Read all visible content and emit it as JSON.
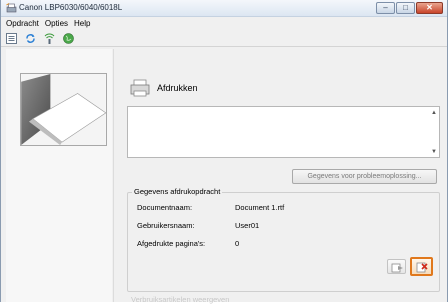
{
  "window": {
    "title": "Canon LBP6030/6040/6018L",
    "caption_buttons": {
      "minimize": "–",
      "maximize": "□",
      "close": "✕"
    }
  },
  "menu": [
    "Opdracht",
    "Opties",
    "Help"
  ],
  "toolbar": {
    "icons": [
      "printer-list-icon",
      "refresh-icon",
      "network-icon",
      "globe-icon"
    ]
  },
  "status": {
    "label": "Afdrukken",
    "icon": "printer-icon"
  },
  "message_box": {
    "text": ""
  },
  "troubleshoot_button": {
    "label": "Gegevens voor probleemoplossing..."
  },
  "job_info": {
    "title": "Gegevens afdrukopdracht",
    "rows": [
      {
        "label": "Documentnaam:",
        "value": "Document 1.rtf"
      },
      {
        "label": "Gebruikersnaam:",
        "value": "User01"
      },
      {
        "label": "Afgedrukte pagina's:",
        "value": "0"
      }
    ]
  },
  "footer_text": "Verbruiksartikelen weergeven",
  "colors": {
    "title_gradient_top": "#f4f7fb",
    "close_button": "#c8442a",
    "highlight": "#e0781c"
  }
}
